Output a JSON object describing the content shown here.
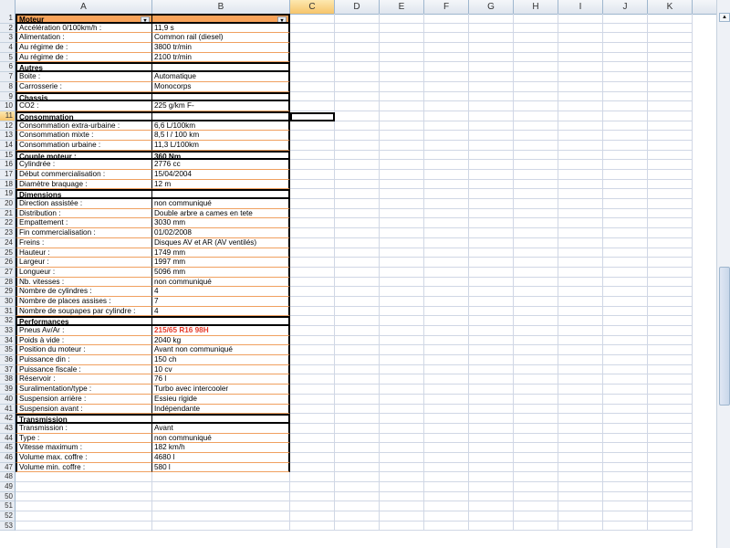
{
  "columns": [
    "A",
    "B",
    "C",
    "D",
    "E",
    "F",
    "G",
    "H",
    "I",
    "J",
    "K"
  ],
  "selected_column": "C",
  "rows": [
    {
      "n": "1",
      "a": "Moteur",
      "b": "",
      "type": "header"
    },
    {
      "n": "2",
      "a": "Accélération 0/100km/h :",
      "b": "11,9 s"
    },
    {
      "n": "3",
      "a": "Alimentation :",
      "b": "Common rail (diesel)"
    },
    {
      "n": "4",
      "a": "Au régime de :",
      "b": "3800 tr/min"
    },
    {
      "n": "5",
      "a": "Au régime de :",
      "b": "2100 tr/min"
    },
    {
      "n": "6",
      "a": "Autres",
      "b": "",
      "type": "section"
    },
    {
      "n": "7",
      "a": "Boite :",
      "b": "Automatique"
    },
    {
      "n": "8",
      "a": "Carrosserie :",
      "b": "Monocorps"
    },
    {
      "n": "9",
      "a": "Chassis",
      "b": "",
      "type": "section"
    },
    {
      "n": "10",
      "a": "CO2 :",
      "b": "225 g/km F-"
    },
    {
      "n": "11",
      "a": "Consommation",
      "b": "",
      "type": "section",
      "selected": true
    },
    {
      "n": "12",
      "a": "Consommation extra-urbaine :",
      "b": "6,6 L/100km"
    },
    {
      "n": "13",
      "a": "Consommation mixte :",
      "b": "8,5 l / 100 km"
    },
    {
      "n": "14",
      "a": "Consommation urbaine :",
      "b": "11,3 L/100km"
    },
    {
      "n": "15",
      "a": "Couple moteur :",
      "b": "360 Nm",
      "type": "boxed"
    },
    {
      "n": "16",
      "a": "Cylindrée :",
      "b": "2776 cc"
    },
    {
      "n": "17",
      "a": "Début commercialisation :",
      "b": "15/04/2004"
    },
    {
      "n": "18",
      "a": "Diamètre braquage :",
      "b": "12 m"
    },
    {
      "n": "19",
      "a": "Dimensions",
      "b": "",
      "type": "section"
    },
    {
      "n": "20",
      "a": "Direction assistée :",
      "b": "non communiqué"
    },
    {
      "n": "21",
      "a": "Distribution :",
      "b": "Double arbre a cames en tete"
    },
    {
      "n": "22",
      "a": "Empattement :",
      "b": "3030 mm"
    },
    {
      "n": "23",
      "a": "Fin commercialisation :",
      "b": "01/02/2008"
    },
    {
      "n": "24",
      "a": "Freins :",
      "b": "Disques AV et AR (AV ventilés)"
    },
    {
      "n": "25",
      "a": "Hauteur :",
      "b": "1749 mm"
    },
    {
      "n": "26",
      "a": "Largeur :",
      "b": "1997 mm"
    },
    {
      "n": "27",
      "a": "Longueur :",
      "b": "5096 mm"
    },
    {
      "n": "28",
      "a": "Nb. vitesses :",
      "b": "non communiqué"
    },
    {
      "n": "29",
      "a": "Nombre de cylindres :",
      "b": "4"
    },
    {
      "n": "30",
      "a": "Nombre de places assises :",
      "b": "7"
    },
    {
      "n": "31",
      "a": "Nombre de soupapes par cylindre :",
      "b": "4"
    },
    {
      "n": "32",
      "a": "Performances",
      "b": "",
      "type": "section"
    },
    {
      "n": "33",
      "a": "Pneus Av/Ar :",
      "b": "215/65 R16 98H",
      "red": true
    },
    {
      "n": "34",
      "a": "Poids à vide :",
      "b": "2040 kg"
    },
    {
      "n": "35",
      "a": "Position du moteur :",
      "b": "Avant non communiqué"
    },
    {
      "n": "36",
      "a": "Puissance din :",
      "b": "150 ch"
    },
    {
      "n": "37",
      "a": "Puissance fiscale :",
      "b": "10 cv"
    },
    {
      "n": "38",
      "a": "Réservoir :",
      "b": "76 l"
    },
    {
      "n": "39",
      "a": "Suralimentation/type :",
      "b": "Turbo avec intercooler"
    },
    {
      "n": "40",
      "a": "Suspension arrière :",
      "b": "Essieu rigide"
    },
    {
      "n": "41",
      "a": "Suspension avant :",
      "b": "Indépendante"
    },
    {
      "n": "42",
      "a": "Transmission",
      "b": "",
      "type": "section"
    },
    {
      "n": "43",
      "a": "Transmission :",
      "b": "Avant"
    },
    {
      "n": "44",
      "a": "Type :",
      "b": "non communiqué"
    },
    {
      "n": "45",
      "a": "Vitesse maximum :",
      "b": "182 km/h"
    },
    {
      "n": "46",
      "a": "Volume max. coffre :",
      "b": "4680 l"
    },
    {
      "n": "47",
      "a": "Volume min. coffre :",
      "b": "580 l"
    },
    {
      "n": "48",
      "a": "",
      "b": ""
    },
    {
      "n": "49",
      "a": "",
      "b": ""
    },
    {
      "n": "50",
      "a": "",
      "b": ""
    },
    {
      "n": "51",
      "a": "",
      "b": ""
    },
    {
      "n": "52",
      "a": "",
      "b": ""
    },
    {
      "n": "53",
      "a": "",
      "b": ""
    }
  ]
}
